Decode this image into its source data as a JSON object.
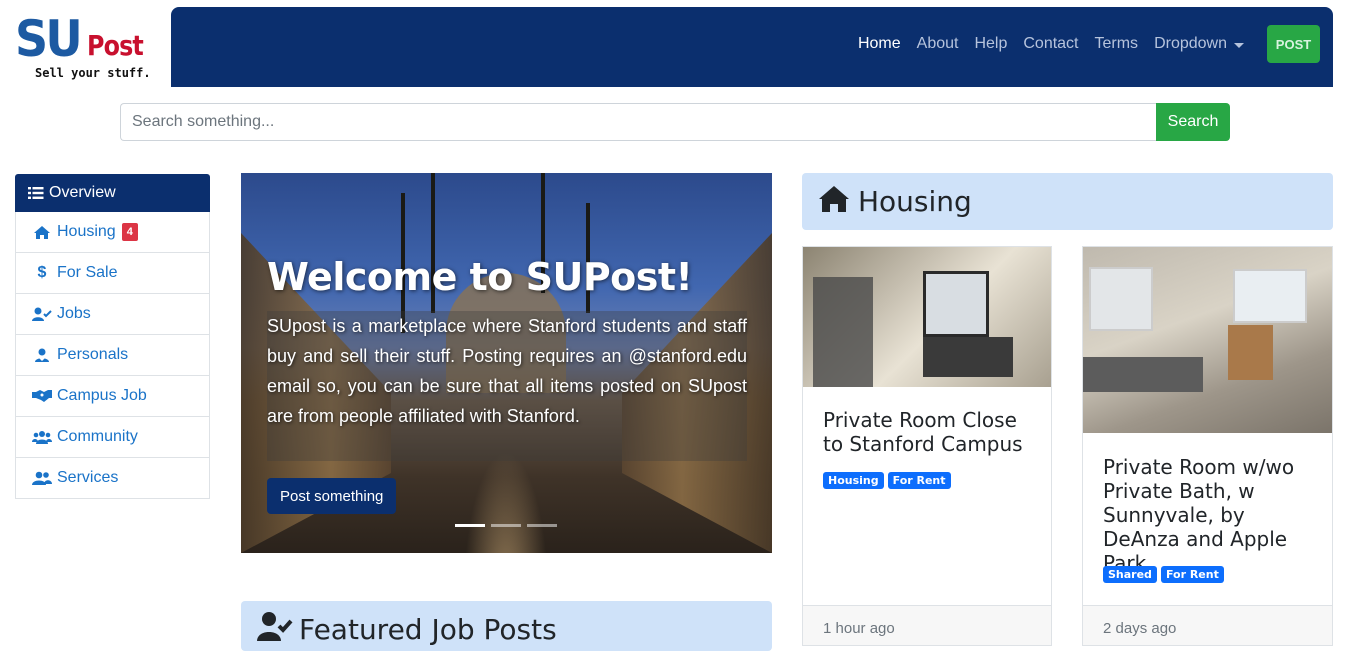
{
  "logo": {
    "su": "SU",
    "post": "Post",
    "tagline": "Sell your stuff."
  },
  "nav": {
    "items": [
      "Home",
      "About",
      "Help",
      "Contact",
      "Terms",
      "Dropdown"
    ],
    "post_button": "POST",
    "colors": {
      "navbar": "#0b2f6e",
      "post_button": "#28a745"
    }
  },
  "search": {
    "placeholder": "Search something...",
    "button": "Search"
  },
  "sidebar": {
    "header": "Overview",
    "items": [
      {
        "label": "Housing",
        "icon": "home-icon",
        "badge": "4"
      },
      {
        "label": "For Sale",
        "icon": "dollar-icon"
      },
      {
        "label": "Jobs",
        "icon": "user-check-icon"
      },
      {
        "label": "Personals",
        "icon": "user-heart-icon"
      },
      {
        "label": "Campus Job",
        "icon": "handshake-icon"
      },
      {
        "label": "Community",
        "icon": "users-icon"
      },
      {
        "label": "Services",
        "icon": "user-friends-icon"
      }
    ]
  },
  "hero": {
    "title_prefix": "Welcome to ",
    "title_brand": "SUPost!",
    "text": "SUpost is a marketplace where Stanford students and staff buy and sell their stuff. Posting requires an @stanford.edu email so, you can be sure that all items posted on SUpost are from people affiliated with Stanford.",
    "button": "Post something",
    "indicators": 3,
    "active_indicator": 0
  },
  "featured": {
    "title": "Featured Job Posts",
    "icon": "user-check-icon"
  },
  "housing": {
    "title": "Housing",
    "icon": "home-icon",
    "cards": [
      {
        "title": "Private Room Close to Stanford Campus",
        "tags": [
          "Housing",
          "For Rent"
        ],
        "time": "1 hour ago"
      },
      {
        "title": "Private Room w/wo Private Bath, w Sunnyvale, by DeAnza and Apple Park",
        "tags": [
          "Shared",
          "For Rent"
        ],
        "time": "2 days ago"
      }
    ]
  }
}
